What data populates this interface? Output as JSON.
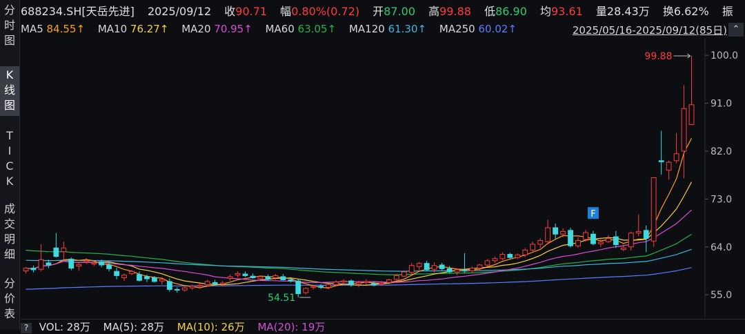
{
  "sidebar": {
    "tabs": [
      {
        "label": "分时图",
        "chars": [
          "分",
          "时",
          "图"
        ],
        "active": false
      },
      {
        "label": "K线图",
        "chars": [
          "K",
          "线",
          "图"
        ],
        "active": true
      },
      {
        "label": "TICK",
        "chars": [
          "T",
          "I",
          "C",
          "K"
        ],
        "active": false
      },
      {
        "label": "成交明细",
        "chars": [
          "成",
          "交",
          "明",
          "细"
        ],
        "active": false
      },
      {
        "label": "分价表",
        "chars": [
          "分",
          "价",
          "表"
        ],
        "active": false
      }
    ]
  },
  "header": {
    "symbol": "688234.SH[天岳先进]",
    "date": "2025/09/12",
    "close_label": "收",
    "close_value": "90.71",
    "change_label": "幅",
    "change_value": "0.80%(0.72)",
    "open_label": "开",
    "open_value": "87.00",
    "high_label": "高",
    "high_value": "99.88",
    "low_label": "低",
    "low_value": "86.90",
    "avg_label": "均",
    "avg_value": "93.61",
    "volume_label": "量",
    "volume_value": "28.43万",
    "turnover_label": "换",
    "turnover_value": "6.62%",
    "amplitude_label": "振"
  },
  "ma_bar": {
    "items": [
      {
        "label": "MA5",
        "value": "84.55↑",
        "color": "#ff9f1c"
      },
      {
        "label": "MA10",
        "value": "76.27↑",
        "color": "#f5d142"
      },
      {
        "label": "MA20",
        "value": "70.95↑",
        "color": "#d64ed6"
      },
      {
        "label": "MA60",
        "value": "63.05↑",
        "color": "#25b34b"
      },
      {
        "label": "MA120",
        "value": "61.30↑",
        "color": "#3fb6e0"
      },
      {
        "label": "MA250",
        "value": "60.02↑",
        "color": "#5a7dff"
      }
    ],
    "date_range": "2025/05/16-2025/09/12(85日)",
    "collapse_icon": "chevron-up-icon"
  },
  "volume_bar": {
    "help_label": "?",
    "items": [
      {
        "label": "VOL: 28万",
        "color": "#e0e0e0"
      },
      {
        "label": "MA(5): 28万",
        "color": "#e0e0e0"
      },
      {
        "label": "MA(10): 26万",
        "color": "#f5d142"
      },
      {
        "label": "MA(20): 19万",
        "color": "#d64ed6"
      }
    ]
  },
  "colors": {
    "up": "#ff3b3b",
    "down": "#3fd9e0",
    "grid": "#2a2c33",
    "background": "#0d0e12"
  },
  "chart_data": {
    "type": "candlestick",
    "ylim": [
      51,
      103
    ],
    "y_ticks": [
      "100.0",
      "91.0",
      "82.0",
      "73.0",
      "64.0",
      "55.0"
    ],
    "high_annotation": "99.88",
    "low_annotation": "54.51",
    "event_marker": "F",
    "candles": [
      [
        59.5,
        60.2,
        59.0,
        60.0
      ],
      [
        60.0,
        60.5,
        59.2,
        59.7
      ],
      [
        59.8,
        64.5,
        59.4,
        61.6
      ],
      [
        61.0,
        61.6,
        60.0,
        60.6
      ],
      [
        63.8,
        66.6,
        62.0,
        62.2
      ],
      [
        63.1,
        65.0,
        61.4,
        63.8
      ],
      [
        61.7,
        62.0,
        59.6,
        60.0
      ],
      [
        60.4,
        61.0,
        59.5,
        60.7
      ],
      [
        61.2,
        61.9,
        60.8,
        61.4
      ],
      [
        60.8,
        61.4,
        60.4,
        61.0
      ],
      [
        61.2,
        61.6,
        60.2,
        60.6
      ],
      [
        60.6,
        61.2,
        59.4,
        59.9
      ],
      [
        59.4,
        60.1,
        57.9,
        58.6
      ],
      [
        58.2,
        59.0,
        57.6,
        58.7
      ],
      [
        59.0,
        59.6,
        58.7,
        59.4
      ],
      [
        58.8,
        59.4,
        57.5,
        57.7
      ],
      [
        58.4,
        58.8,
        57.4,
        58.0
      ],
      [
        58.2,
        58.5,
        57.3,
        57.5
      ],
      [
        57.6,
        58.3,
        56.9,
        57.9
      ],
      [
        57.5,
        58.1,
        55.6,
        56.0
      ],
      [
        56.0,
        56.4,
        55.4,
        55.9
      ],
      [
        55.9,
        56.6,
        55.6,
        56.3
      ],
      [
        56.3,
        56.9,
        55.9,
        56.6
      ],
      [
        56.6,
        57.2,
        56.1,
        56.8
      ],
      [
        56.9,
        57.8,
        56.6,
        57.5
      ],
      [
        57.3,
        57.8,
        56.8,
        57.0
      ],
      [
        57.0,
        57.6,
        56.6,
        57.2
      ],
      [
        58.1,
        58.8,
        57.6,
        58.4
      ],
      [
        58.7,
        59.4,
        58.3,
        59.0
      ],
      [
        58.9,
        59.4,
        58.3,
        58.6
      ],
      [
        58.5,
        59.0,
        58.0,
        58.2
      ],
      [
        58.0,
        58.6,
        57.6,
        58.4
      ],
      [
        58.4,
        58.8,
        57.7,
        57.9
      ],
      [
        58.2,
        58.9,
        57.8,
        58.6
      ],
      [
        58.4,
        58.9,
        57.7,
        57.8
      ],
      [
        57.8,
        58.3,
        57.3,
        57.6
      ],
      [
        57.6,
        57.9,
        54.5,
        55.2
      ],
      [
        55.4,
        56.4,
        55.1,
        56.2
      ],
      [
        56.4,
        56.9,
        56.0,
        56.6
      ],
      [
        56.6,
        57.0,
        56.1,
        56.4
      ],
      [
        56.4,
        57.1,
        56.0,
        56.9
      ],
      [
        56.9,
        57.7,
        56.6,
        57.4
      ],
      [
        57.4,
        57.9,
        57.0,
        57.6
      ],
      [
        57.6,
        57.9,
        56.5,
        56.9
      ],
      [
        57.0,
        57.6,
        56.4,
        57.3
      ],
      [
        57.3,
        57.9,
        56.9,
        57.5
      ],
      [
        57.1,
        57.5,
        56.6,
        56.8
      ],
      [
        57.0,
        57.6,
        56.7,
        57.2
      ],
      [
        57.3,
        58.0,
        57.0,
        57.8
      ],
      [
        57.9,
        58.9,
        57.6,
        58.6
      ],
      [
        58.5,
        59.6,
        58.3,
        59.3
      ],
      [
        59.2,
        61.0,
        58.8,
        60.5
      ],
      [
        60.3,
        61.2,
        59.6,
        60.9
      ],
      [
        60.9,
        61.4,
        59.4,
        59.7
      ],
      [
        59.8,
        61.1,
        59.2,
        60.5
      ],
      [
        60.6,
        61.0,
        59.6,
        59.9
      ],
      [
        59.9,
        60.4,
        59.0,
        59.3
      ],
      [
        59.3,
        60.0,
        58.7,
        59.7
      ],
      [
        59.6,
        62.8,
        59.1,
        59.5
      ],
      [
        59.5,
        60.3,
        59.2,
        60.0
      ],
      [
        60.0,
        60.8,
        59.6,
        60.6
      ],
      [
        60.6,
        61.7,
        60.2,
        61.4
      ],
      [
        61.4,
        62.2,
        61.0,
        61.8
      ],
      [
        61.8,
        63.0,
        61.5,
        62.6
      ],
      [
        62.6,
        62.9,
        61.8,
        62.0
      ],
      [
        62.0,
        62.8,
        61.7,
        62.5
      ],
      [
        62.5,
        63.8,
        62.1,
        63.4
      ],
      [
        63.4,
        65.0,
        63.0,
        64.5
      ],
      [
        64.5,
        65.6,
        63.8,
        65.2
      ],
      [
        65.0,
        69.1,
        64.5,
        67.6
      ],
      [
        67.6,
        68.4,
        65.4,
        66.4
      ],
      [
        66.4,
        67.5,
        65.8,
        66.9
      ],
      [
        67.1,
        67.6,
        63.9,
        64.2
      ],
      [
        64.2,
        65.8,
        63.8,
        65.2
      ],
      [
        65.4,
        67.2,
        65.0,
        66.7
      ],
      [
        66.4,
        67.0,
        64.3,
        64.6
      ],
      [
        64.6,
        65.5,
        64.0,
        64.9
      ],
      [
        65.0,
        66.2,
        64.7,
        65.6
      ],
      [
        65.9,
        67.0,
        63.8,
        64.4
      ],
      [
        63.5,
        64.5,
        63.2,
        63.8
      ],
      [
        64.0,
        66.9,
        63.3,
        66.6
      ],
      [
        66.6,
        70.1,
        66.0,
        66.9
      ],
      [
        67.1,
        68.0,
        63.0,
        65.6
      ],
      [
        65.1,
        77.0,
        64.0,
        77.0
      ],
      [
        80.2,
        85.8,
        77.6,
        80.0
      ],
      [
        78.4,
        80.2,
        76.6,
        79.9
      ],
      [
        80.2,
        85.4,
        79.7,
        81.5
      ],
      [
        82.0,
        94.4,
        76.9,
        90.0
      ],
      [
        87.0,
        99.88,
        86.9,
        90.71
      ]
    ]
  }
}
